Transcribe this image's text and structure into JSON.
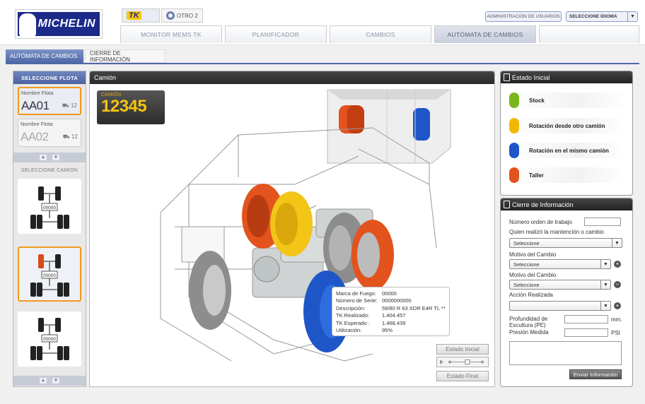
{
  "brand": {
    "logo_text": "MICHELIN"
  },
  "brand_tabs": [
    {
      "label": "TK"
    },
    {
      "label": "OTRO 2"
    }
  ],
  "header": {
    "admin_label": "ADMINISTRACIÓN DE USUARIOS",
    "lang_label": "SELECCIONE IDIOMA"
  },
  "main_nav": [
    {
      "label": "MONITOR MEMS TK",
      "active": false
    },
    {
      "label": "PLANIFICADOR",
      "active": false
    },
    {
      "label": "CAMBIOS",
      "active": false
    },
    {
      "label": "AUTÓMATA DE CAMBIOS",
      "active": true
    },
    {
      "label": "",
      "active": false
    }
  ],
  "sub_tabs": [
    {
      "label": "AUTÓMATA DE CAMBIOS",
      "active": true
    },
    {
      "label": "CIERRE DE INFORMACIÓN",
      "active": false
    }
  ],
  "fleet_panel": {
    "title": "SELECCIONE FLOTA",
    "fleets": [
      {
        "name_label": "Nombre Flota",
        "code": "AA01",
        "count": "12",
        "selected": true
      },
      {
        "name_label": "Nombre Flota",
        "code": "AA02",
        "count": "12",
        "selected": false
      }
    ],
    "truck_title": "SELECCIONE CAMIÓN",
    "trucks": [
      {
        "id": "00000"
      },
      {
        "id": "00000"
      },
      {
        "id": "00000"
      }
    ]
  },
  "truck_pane": {
    "title": "Camión",
    "camion_label": "CAMIÓN",
    "camion_number": "12345",
    "info": [
      {
        "k": "Marca de Fuego:",
        "v": "00000"
      },
      {
        "k": "Número de Serie:",
        "v": "0000000000"
      },
      {
        "k": "Descripción:",
        "v": "59/80 R 63 XDR E4R TL **"
      },
      {
        "k": "TK Realizado:",
        "v": "1.404.457"
      },
      {
        "k": "TK Esperado :",
        "v": "1.468.439"
      },
      {
        "k": "Utilización:",
        "v": "95%"
      }
    ],
    "btn_initial": "Estado Inicial",
    "btn_final": "Estado Final"
  },
  "estado": {
    "title": "Estado Inicial",
    "items": [
      {
        "label": "Stock",
        "color": "#7ab51d"
      },
      {
        "label": "Rotación desde otro camión",
        "color": "#f2b705"
      },
      {
        "label": "Rotación en el mismo camión",
        "color": "#1e56c8"
      },
      {
        "label": "Taller",
        "color": "#e2531d"
      }
    ]
  },
  "cierre": {
    "title": "Cierre de Información",
    "orden_label": "Número orden de trabajo",
    "quien_label": "Quien realizó la mantención o cambio",
    "quien_value": "Seleccione",
    "motivo1_label": "Motivo del Cambio",
    "motivo1_value": "Seleccione",
    "motivo2_label": "Motivo del Cambio",
    "motivo2_value": "Seleccione",
    "accion_label": "Acción Realizada",
    "accion_value": "",
    "prof_label": "Profundidad de Escultura (PE)",
    "prof_unit": "mm.",
    "presion_label": "Presión Medida",
    "presion_unit": "PSI",
    "send_label": "Enviar Información"
  }
}
